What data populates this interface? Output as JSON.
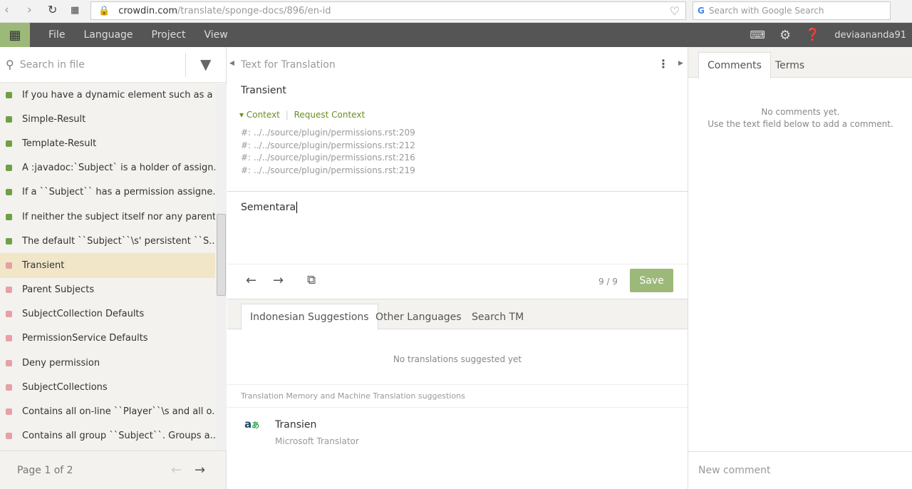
{
  "browser": {
    "url_host": "crowdin.com",
    "url_path": "/translate/sponge-docs/896/en-id",
    "search_placeholder": "Search with Google Search"
  },
  "appbar": {
    "menus": [
      "File",
      "Language",
      "Project",
      "View"
    ],
    "username": "deviaananda91"
  },
  "sidebar": {
    "search_placeholder": "Search in file",
    "items": [
      {
        "text": "If you have a dynamic element such as a ...",
        "status": "translated"
      },
      {
        "text": "Simple-Result",
        "status": "translated"
      },
      {
        "text": "Template-Result",
        "status": "translated"
      },
      {
        "text": "A :javadoc:`Subject` is a holder of assign...",
        "status": "translated"
      },
      {
        "text": "If a ``Subject`` has a permission assigne...",
        "status": "translated"
      },
      {
        "text": "If neither the subject itself nor any parent...",
        "status": "translated"
      },
      {
        "text": "The default ``Subject``\\s' persistent ``S...",
        "status": "translated"
      },
      {
        "text": "Transient",
        "status": "untranslated"
      },
      {
        "text": "Parent Subjects",
        "status": "untranslated"
      },
      {
        "text": "SubjectCollection Defaults",
        "status": "untranslated"
      },
      {
        "text": "PermissionService Defaults",
        "status": "untranslated"
      },
      {
        "text": "Deny permission",
        "status": "untranslated"
      },
      {
        "text": "SubjectCollections",
        "status": "untranslated"
      },
      {
        "text": "Contains all on-line ``Player``\\s and all o...",
        "status": "untranslated"
      },
      {
        "text": "Contains all group ``Subject``. Groups a...",
        "status": "untranslated"
      }
    ],
    "pager": "Page 1 of 2"
  },
  "main": {
    "header": "Text for Translation",
    "source": "Transient",
    "context_label": "Context",
    "request_context": "Request Context",
    "context_lines": [
      "#: ../../source/plugin/permissions.rst:209",
      "#: ../../source/plugin/permissions.rst:212",
      "#: ../../source/plugin/permissions.rst:216",
      "#: ../../source/plugin/permissions.rst:219"
    ],
    "translation": "Sementara",
    "counter": "9 / 9",
    "save": "Save",
    "tabs": [
      "Indonesian Suggestions",
      "Other Languages",
      "Search TM"
    ],
    "no_suggestions": "No translations suggested yet",
    "tm_header": "Translation Memory and Machine Translation suggestions",
    "mt": {
      "text": "Transien",
      "source": "Microsoft Translator"
    }
  },
  "right": {
    "tabs": [
      "Comments",
      "Terms"
    ],
    "empty1": "No comments yet.",
    "empty2": "Use the text field below to add a comment.",
    "new_comment_placeholder": "New comment"
  },
  "colors": {
    "accent": "#9cb97a",
    "translated": "#6ea046",
    "untranslated": "#e7a0a4"
  }
}
